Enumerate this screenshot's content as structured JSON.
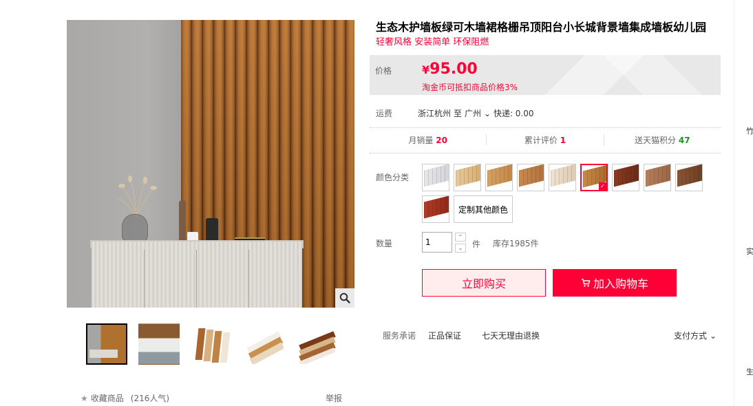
{
  "product": {
    "title": "生态木护墙板绿可木墙裙格栅吊顶阳台小长城背景墙集成墙板幼儿园",
    "subtitle": "轻奢风格 安装简单 环保阻燃"
  },
  "price": {
    "label": "价格",
    "currency": "¥",
    "value": "95.00",
    "coin_note": "淘金币可抵扣商品价格3%"
  },
  "shipping": {
    "label": "运费",
    "origin": "浙江杭州",
    "to": "至",
    "destination": "广州",
    "express": "快递: 0.00"
  },
  "stats": [
    {
      "label": "月销量",
      "value": "20",
      "color": "red"
    },
    {
      "label": "累计评价",
      "value": "1",
      "color": "red"
    },
    {
      "label": "送天猫积分",
      "value": "47",
      "color": "green"
    }
  ],
  "colors": {
    "label": "颜色分类",
    "swatches": [
      {
        "c1": "#e7e7e9",
        "c2": "#d4d5d8"
      },
      {
        "c1": "#e9c99a",
        "c2": "#d6ae72"
      },
      {
        "c1": "#d8a264",
        "c2": "#c38743"
      },
      {
        "c1": "#c9884e",
        "c2": "#b3733a"
      },
      {
        "c1": "#efe2cf",
        "c2": "#ddcbb2"
      },
      {
        "c1": "#c88a46",
        "c2": "#a86a2c"
      },
      {
        "c1": "#8a3a22",
        "c2": "#6e2a16"
      },
      {
        "c1": "#b87f5a",
        "c2": "#9c6646"
      },
      {
        "c1": "#8c5434",
        "c2": "#6f3e22"
      },
      {
        "c1": "#b23a24",
        "c2": "#922a18"
      }
    ],
    "selected_index": 5,
    "custom_label": "定制其他颜色"
  },
  "quantity": {
    "label": "数量",
    "value": "1",
    "unit": "件",
    "stock": "库存1985件"
  },
  "actions": {
    "buy_now": "立即购买",
    "add_cart": "加入购物车"
  },
  "services": {
    "label": "服务承诺",
    "items": [
      "正品保证",
      "七天无理由退换"
    ],
    "payment": "支付方式"
  },
  "gallery": {
    "favorite": "收藏商品",
    "popularity": "(216人气)",
    "report": "举报"
  },
  "sidebar": {
    "chars": [
      "竹",
      "实",
      "生"
    ]
  },
  "brand_color": "#ff0036"
}
